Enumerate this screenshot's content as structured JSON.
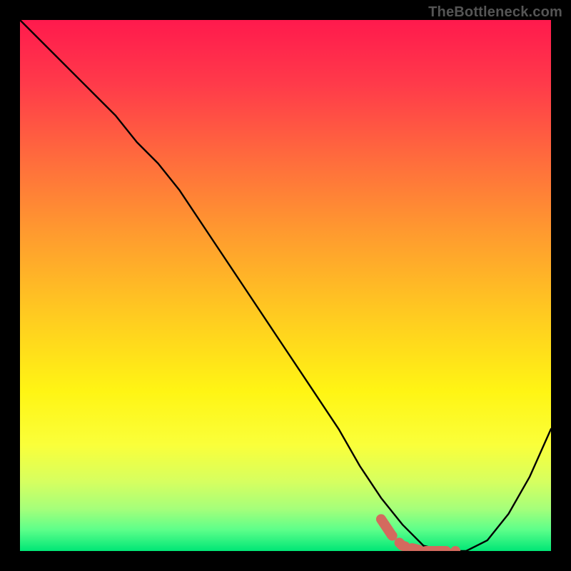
{
  "watermark": "TheBottleneck.com",
  "chart_data": {
    "type": "line",
    "title": "",
    "xlabel": "",
    "ylabel": "",
    "xlim": [
      0,
      100
    ],
    "ylim": [
      0,
      100
    ],
    "series": [
      {
        "name": "bottleneck-curve",
        "x": [
          0,
          6,
          12,
          18,
          22,
          26,
          30,
          36,
          42,
          48,
          54,
          60,
          64,
          68,
          72,
          76,
          80,
          84,
          88,
          92,
          96,
          100
        ],
        "y": [
          100,
          94,
          88,
          82,
          77,
          73,
          68,
          59,
          50,
          41,
          32,
          23,
          16,
          10,
          5,
          1,
          0,
          0,
          2,
          7,
          14,
          23
        ]
      }
    ],
    "highlight": {
      "name": "optimal-segment",
      "color": "#d36a5e",
      "x": [
        68,
        70,
        72,
        76,
        80,
        82
      ],
      "y": [
        6,
        3,
        1,
        0,
        0,
        0
      ]
    },
    "gradient_stops": [
      {
        "pos": 0,
        "color": "#ff1a4d"
      },
      {
        "pos": 12,
        "color": "#ff3a4a"
      },
      {
        "pos": 26,
        "color": "#ff6b3d"
      },
      {
        "pos": 40,
        "color": "#ff9a2f"
      },
      {
        "pos": 55,
        "color": "#ffc921"
      },
      {
        "pos": 70,
        "color": "#fff514"
      },
      {
        "pos": 80,
        "color": "#faff3a"
      },
      {
        "pos": 87,
        "color": "#d6ff60"
      },
      {
        "pos": 92,
        "color": "#a6ff7a"
      },
      {
        "pos": 96,
        "color": "#5dff8a"
      },
      {
        "pos": 100,
        "color": "#00e676"
      }
    ]
  }
}
